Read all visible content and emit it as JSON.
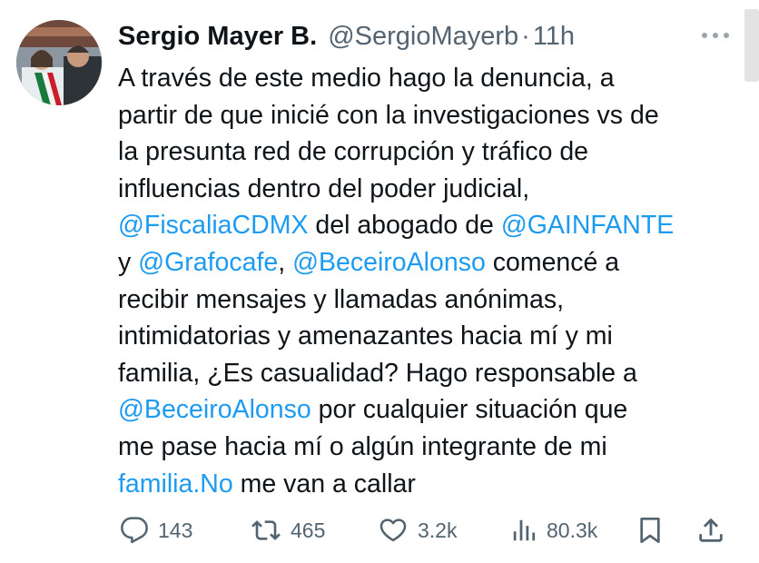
{
  "tweet": {
    "display_name": "Sergio Mayer B.",
    "handle": "@SergioMayerb",
    "separator": "·",
    "time": "11h",
    "lines": [
      [
        {
          "text": "A través de este medio hago la denuncia, a",
          "link": false
        }
      ],
      [
        {
          "text": "partir de que inicié con la investigaciones vs de",
          "link": false
        }
      ],
      [
        {
          "text": "la presunta red de corrupción y tráfico de",
          "link": false
        }
      ],
      [
        {
          "text": "influencias dentro del poder judicial,",
          "link": false
        }
      ],
      [
        {
          "text": "@FiscaliaCDMX",
          "link": true
        },
        {
          "text": " del abogado de ",
          "link": false
        },
        {
          "text": "@GAINFANTE",
          "link": true
        }
      ],
      [
        {
          "text": "y ",
          "link": false
        },
        {
          "text": "@Grafocafe",
          "link": true
        },
        {
          "text": ", ",
          "link": false
        },
        {
          "text": "@BeceiroAlonso",
          "link": true
        },
        {
          "text": " comencé a",
          "link": false
        }
      ],
      [
        {
          "text": "recibir mensajes y llamadas anónimas,",
          "link": false
        }
      ],
      [
        {
          "text": "intimidatorias y amenazantes hacia mí y mi",
          "link": false
        }
      ],
      [
        {
          "text": "familia, ¿Es casualidad? Hago responsable a",
          "link": false
        }
      ],
      [
        {
          "text": "@BeceiroAlonso",
          "link": true
        },
        {
          "text": " por cualquier situación que",
          "link": false
        }
      ],
      [
        {
          "text": "me pase hacia mí o algún integrante de mi",
          "link": false
        }
      ],
      [
        {
          "text": "familia.No",
          "link": true
        },
        {
          "text": " me van a callar",
          "link": false
        }
      ]
    ]
  },
  "actions": {
    "replies": "143",
    "retweets": "465",
    "likes": "3.2k",
    "views": "80.3k"
  },
  "colors": {
    "text": "#0f1419",
    "secondary": "#536471",
    "link": "#1d9bf0"
  },
  "icons": [
    "more-icon",
    "reply-icon",
    "retweet-icon",
    "like-icon",
    "views-icon",
    "bookmark-icon",
    "share-icon"
  ]
}
